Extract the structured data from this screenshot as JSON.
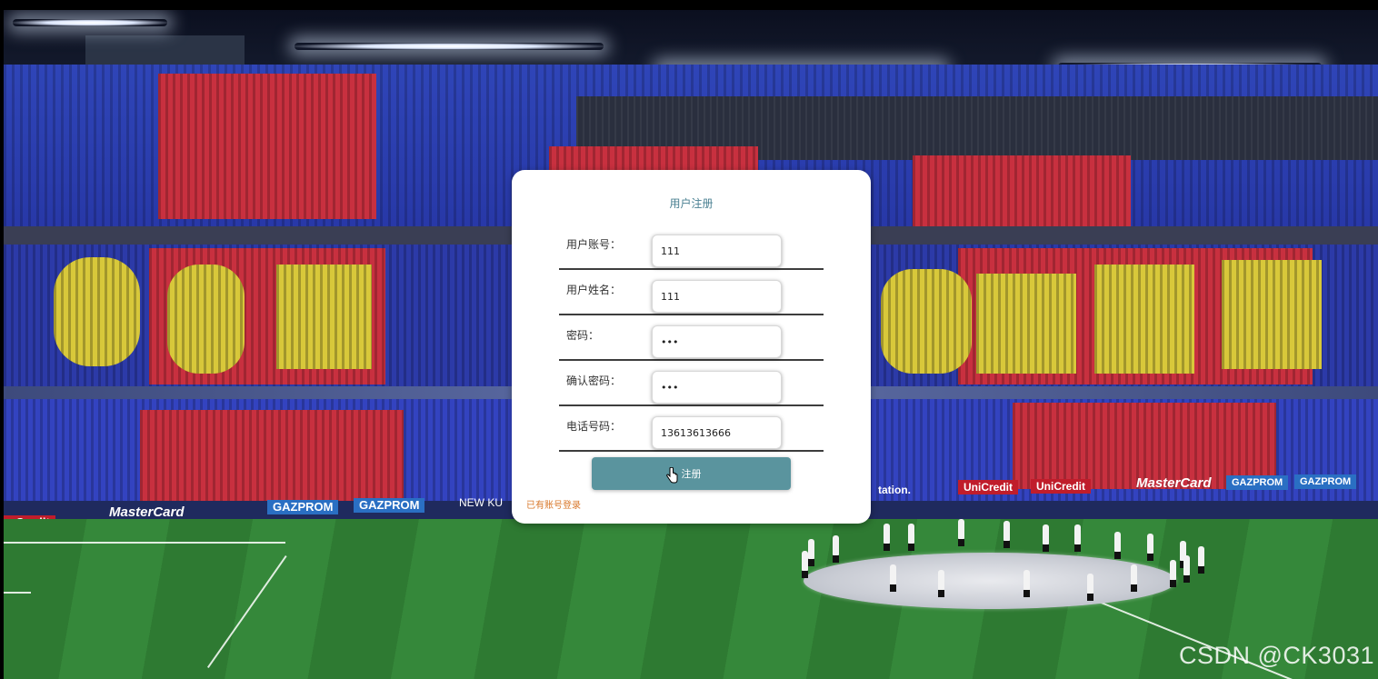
{
  "form": {
    "title": "用户注册",
    "fields": [
      {
        "label": "用户账号：",
        "value": "111",
        "type": "text"
      },
      {
        "label": "用户姓名：",
        "value": "111",
        "type": "text"
      },
      {
        "label": "密码：",
        "value": "•••",
        "type": "password"
      },
      {
        "label": "确认密码：",
        "value": "•••",
        "type": "password"
      },
      {
        "label": "电话号码：",
        "value": "13613613666",
        "type": "text"
      }
    ],
    "submit_label": "注册",
    "login_link": "已有账号登录"
  },
  "background": {
    "ads": [
      "MasterCard",
      "GAZPROM",
      "GAZPROM",
      "NEW KU",
      "UniCredit",
      "UniCredit",
      "MasterCard",
      "GAZPROM",
      "GAZPROM",
      "tation.",
      "aCredit"
    ]
  },
  "watermark": "CSDN @CK3031",
  "colors": {
    "accent": "#5a949e",
    "title": "#4a8092",
    "link": "#d8772a"
  }
}
